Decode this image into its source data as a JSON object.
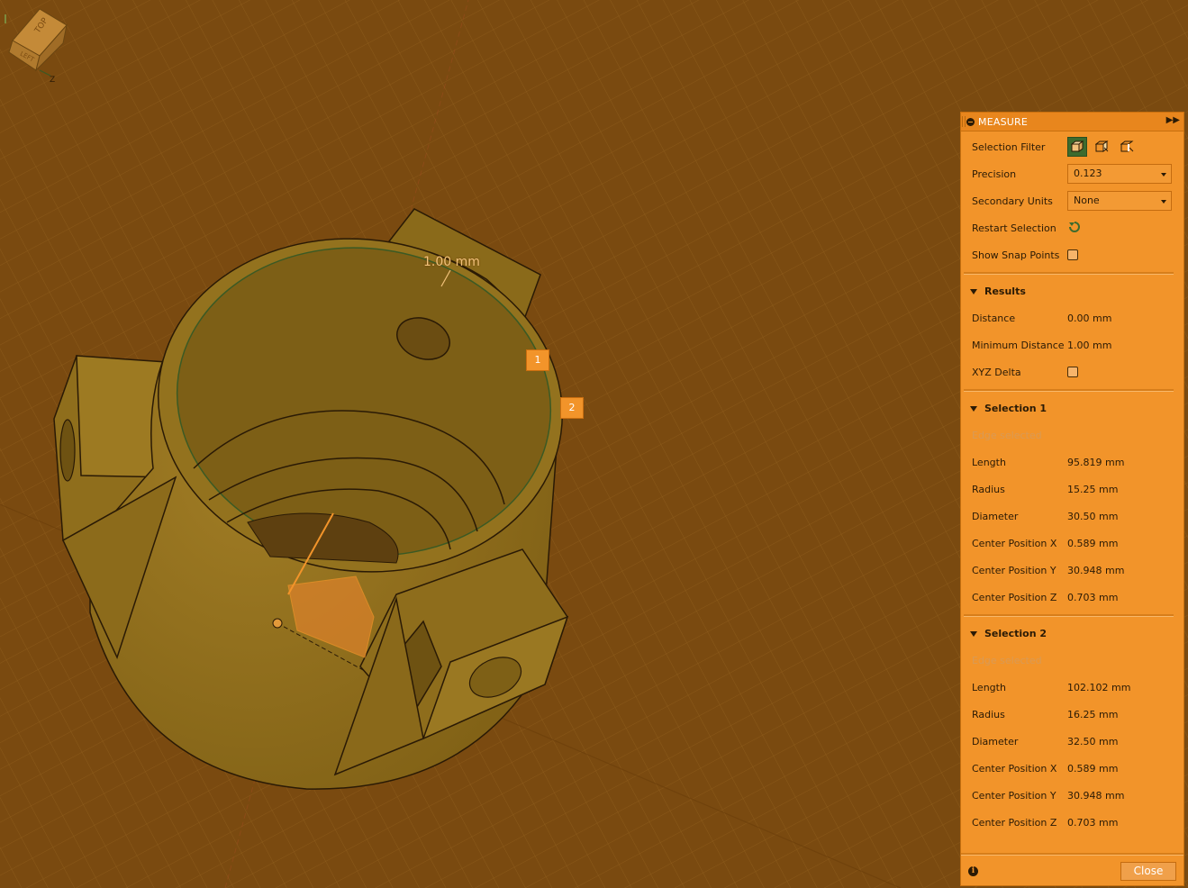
{
  "viewport": {
    "dimension_label": "1.00 mm",
    "markers": [
      "1",
      "2"
    ],
    "viewcube": {
      "top": "TOP",
      "left": "LEFT",
      "axis": "Z"
    }
  },
  "panel": {
    "title": "MEASURE",
    "selection_filter_label": "Selection Filter",
    "precision_label": "Precision",
    "precision_value": "0.123",
    "secondary_units_label": "Secondary Units",
    "secondary_units_value": "None",
    "restart_selection_label": "Restart Selection",
    "show_snap_points_label": "Show Snap Points",
    "results": {
      "title": "Results",
      "distance_label": "Distance",
      "distance_value": "0.00 mm",
      "min_distance_label": "Minimum Distance",
      "min_distance_value": "1.00 mm",
      "xyz_delta_label": "XYZ Delta"
    },
    "selection1": {
      "title": "Selection 1",
      "status": "Edge selected",
      "rows": [
        {
          "label": "Length",
          "value": "95.819 mm"
        },
        {
          "label": "Radius",
          "value": "15.25 mm"
        },
        {
          "label": "Diameter",
          "value": "30.50 mm"
        },
        {
          "label": "Center Position X",
          "value": "0.589 mm"
        },
        {
          "label": "Center Position Y",
          "value": "30.948 mm"
        },
        {
          "label": "Center Position Z",
          "value": "0.703 mm"
        }
      ]
    },
    "selection2": {
      "title": "Selection 2",
      "status": "Edge selected",
      "rows": [
        {
          "label": "Length",
          "value": "102.102 mm"
        },
        {
          "label": "Radius",
          "value": "16.25 mm"
        },
        {
          "label": "Diameter",
          "value": "32.50 mm"
        },
        {
          "label": "Center Position X",
          "value": "0.589 mm"
        },
        {
          "label": "Center Position Y",
          "value": "30.948 mm"
        },
        {
          "label": "Center Position Z",
          "value": "0.703 mm"
        }
      ]
    },
    "close_label": "Close"
  },
  "colors": {
    "panel": "#f2942a",
    "viewport": "#7a4a10",
    "model": "#a37a22",
    "filter_active": "#3d6b2e"
  }
}
